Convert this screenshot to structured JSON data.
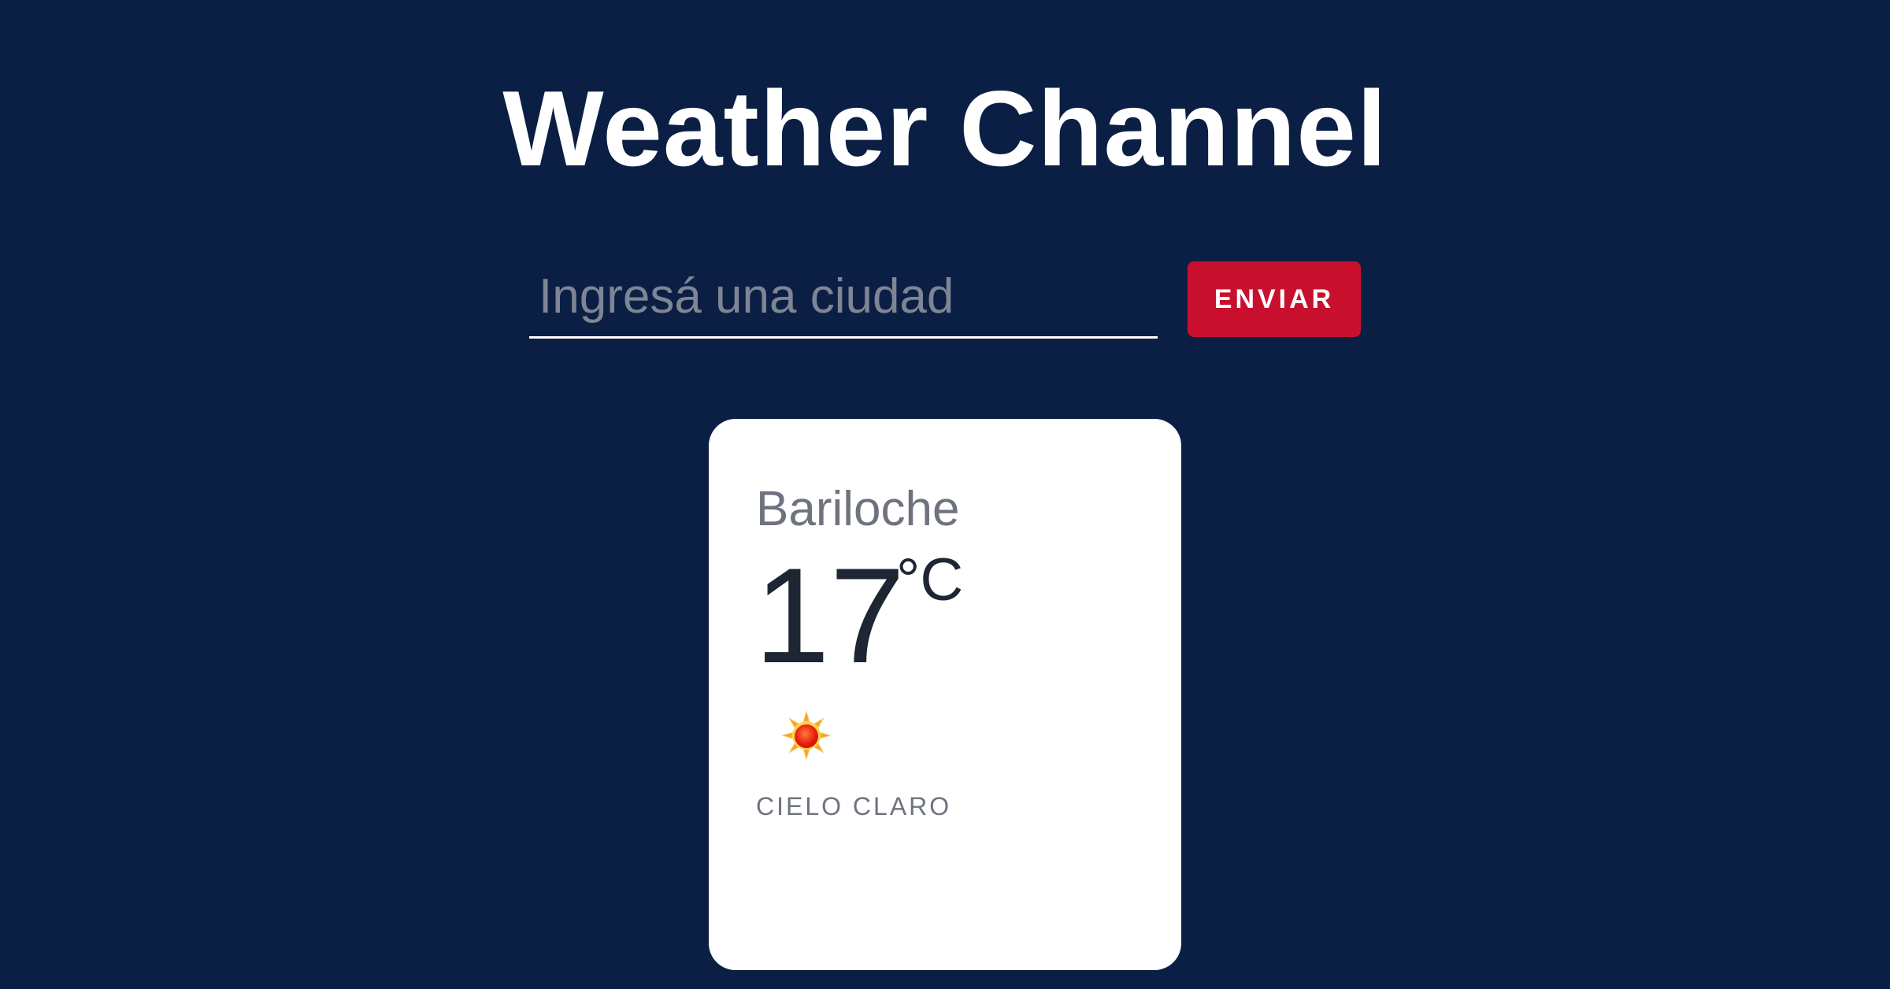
{
  "app": {
    "title": "Weather Channel"
  },
  "search": {
    "placeholder": "Ingresá una ciudad",
    "value": "",
    "submit_label": "ENVIAR"
  },
  "weather": {
    "city": "Bariloche",
    "temperature": "17",
    "unit": "°C",
    "icon": "sun-icon",
    "description": "CIELO CLARO"
  },
  "colors": {
    "background": "#0b1f45",
    "accent": "#c8102e",
    "card": "#ffffff",
    "muted_text": "#6f7380",
    "dark_text": "#1e2533"
  }
}
